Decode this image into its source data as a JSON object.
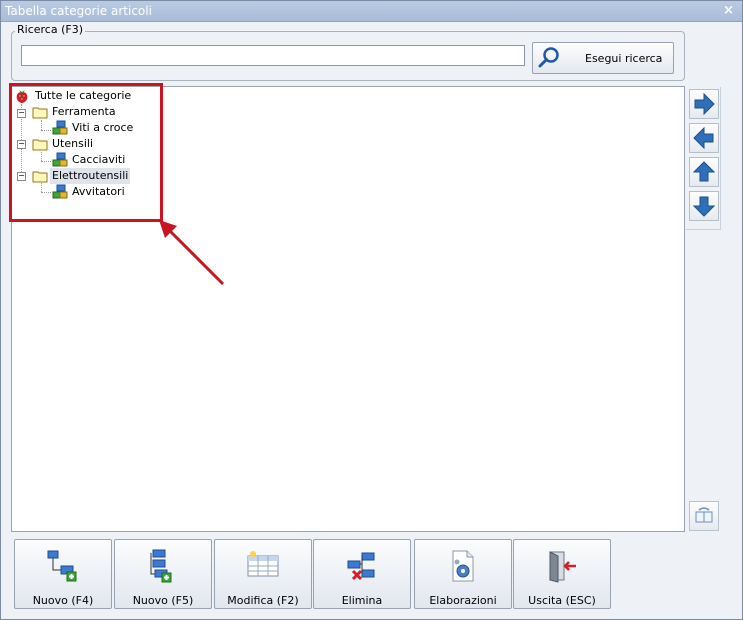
{
  "window": {
    "title": "Tabella categorie articoli",
    "close_label": "×"
  },
  "search": {
    "group_label": "Ricerca (F3)",
    "input_value": "",
    "button_label": "Esegui ricerca"
  },
  "tree": {
    "root": "Tutte le categorie",
    "nodes": [
      {
        "label": "Ferramenta",
        "expander": "−",
        "children": [
          "Viti a croce"
        ]
      },
      {
        "label": "Utensili",
        "expander": "−",
        "children": [
          "Cacciaviti"
        ]
      },
      {
        "label": "Elettroutensili",
        "expander": "−",
        "children": [
          "Avvitatori"
        ]
      }
    ],
    "selected": "Elettroutensili"
  },
  "side_toolbar": {
    "icons": [
      "arrow-right-icon",
      "arrow-left-icon",
      "arrow-up-icon",
      "arrow-down-icon"
    ]
  },
  "actions": [
    {
      "label": "Nuovo (F4)",
      "icon": "new-sibling-icon"
    },
    {
      "label": "Nuovo (F5)",
      "icon": "new-child-icon"
    },
    {
      "label": "Modifica (F2)",
      "icon": "edit-table-icon"
    },
    {
      "label": "Elimina",
      "icon": "delete-node-icon"
    },
    {
      "label": "Elaborazioni",
      "icon": "processing-gear-icon"
    },
    {
      "label": "Uscita (ESC)",
      "icon": "exit-door-icon"
    }
  ],
  "colors": {
    "highlight": "#c9151f",
    "arrow_blue": "#2f6fb8",
    "title_bar": "#b9cbe3"
  }
}
